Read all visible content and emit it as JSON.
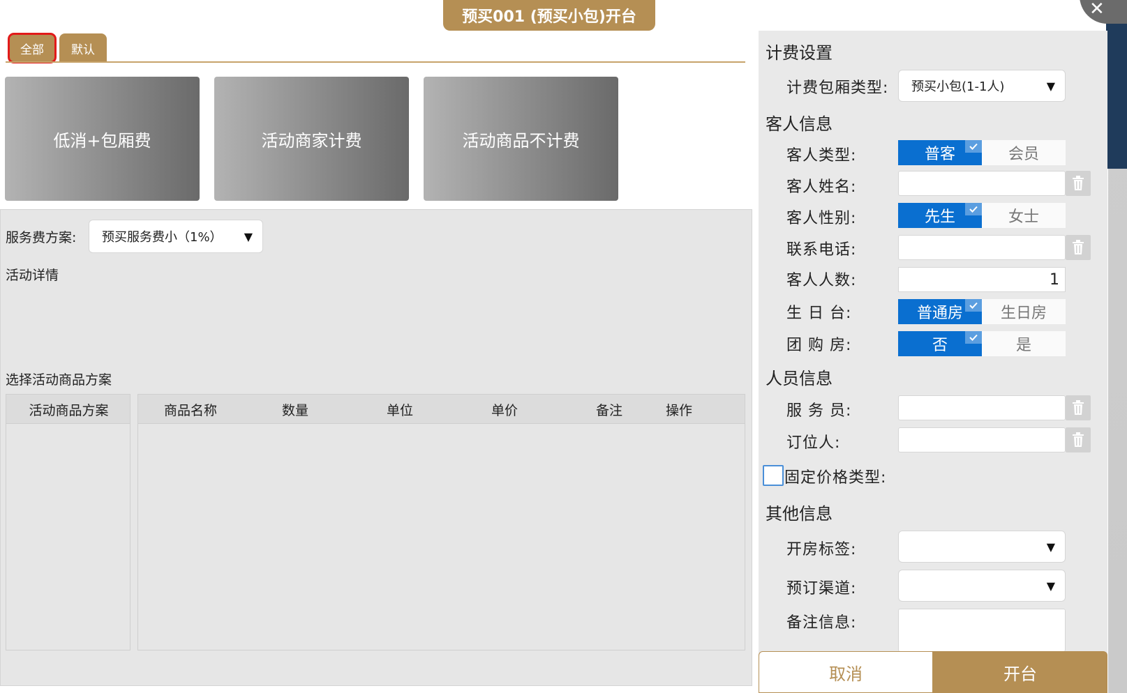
{
  "window": {
    "title": "预买001 (预买小包)开台",
    "close_glyph": "✕"
  },
  "categories": [
    {
      "label": "全部",
      "active": true
    },
    {
      "label": "默认",
      "active": false
    }
  ],
  "plans": [
    {
      "label": "低消+包厢费"
    },
    {
      "label": "活动商家计费"
    },
    {
      "label": "活动商品不计费"
    }
  ],
  "service_fee": {
    "label": "服务费方案:",
    "value": "预买服务费小（1%）"
  },
  "activity_detail_label": "活动详情",
  "goods_plan_section_label": "选择活动商品方案",
  "goods_table": {
    "left_header": "活动商品方案",
    "columns": [
      "商品名称",
      "数量",
      "单位",
      "单价",
      "备注",
      "操作"
    ]
  },
  "billing": {
    "section_title": "计费设置",
    "room_type_label": "计费包厢类型:",
    "room_type_value": "预买小包(1-1人)"
  },
  "guest": {
    "section_title": "客人信息",
    "type_label": "客人类型:",
    "type_options": [
      "普客",
      "会员"
    ],
    "name_label": "客人姓名:",
    "name_value": "",
    "gender_label": "客人性别:",
    "gender_options": [
      "先生",
      "女士"
    ],
    "phone_label": "联系电话:",
    "phone_value": "",
    "count_label": "客人人数:",
    "count_value": "1",
    "birthday_label": "生 日 台:",
    "birthday_options": [
      "普通房",
      "生日房"
    ],
    "group_label": "团 购 房:",
    "group_options": [
      "否",
      "是"
    ]
  },
  "staff": {
    "section_title": "人员信息",
    "waiter_label": "服 务 员:",
    "waiter_value": "",
    "booker_label": "订位人:",
    "booker_value": ""
  },
  "fixed_price_label": "固定价格类型:",
  "other": {
    "section_title": "其他信息",
    "tag_label": "开房标签:",
    "tag_value": "",
    "channel_label": "预订渠道:",
    "channel_value": "",
    "remark_label": "备注信息:",
    "remark_value": ""
  },
  "buttons": {
    "cancel": "取消",
    "open": "开台"
  },
  "icons": {
    "dropdown": "▼",
    "check": "✓",
    "trash": "trash-icon"
  },
  "colors": {
    "gold": "#b58f54",
    "blue": "#0a6fd0",
    "active_outline": "#e21a1a"
  }
}
